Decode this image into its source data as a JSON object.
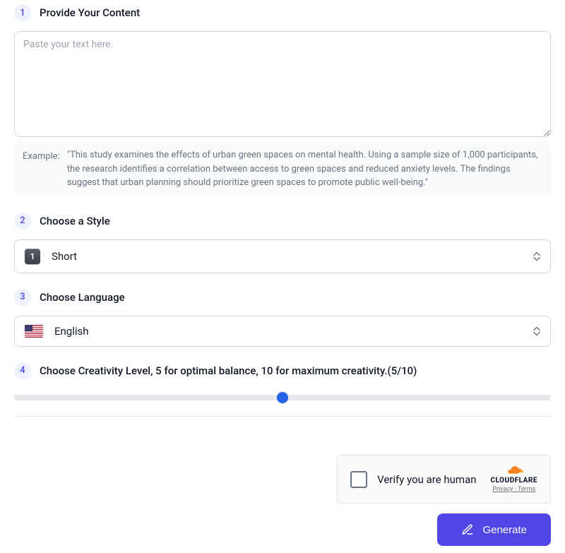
{
  "steps": {
    "s1": {
      "num": "1",
      "title": "Provide Your Content"
    },
    "s2": {
      "num": "2",
      "title": "Choose a Style"
    },
    "s3": {
      "num": "3",
      "title": "Choose Language"
    },
    "s4": {
      "num": "4",
      "title": "Choose Creativity Level, 5 for optimal balance, 10 for maximum creativity.(5/10)"
    }
  },
  "content": {
    "placeholder": "Paste your text here.",
    "value": ""
  },
  "example": {
    "label": "Example:",
    "text": "\"This study examines the effects of urban green spaces on mental health. Using a sample size of 1,000 participants, the research identifies a correlation between access to green spaces and reduced anxiety levels. The findings suggest that urban planning should prioritize green spaces to promote public well-being.\""
  },
  "style": {
    "icon_label": "1",
    "selected": "Short"
  },
  "language": {
    "selected": "English"
  },
  "creativity": {
    "min": 0,
    "max": 10,
    "value": 5
  },
  "captcha": {
    "label": "Verify you are human",
    "brand": "CLOUDFLARE",
    "privacy": "Privacy",
    "sep": " · ",
    "terms": "Terms"
  },
  "actions": {
    "generate": "Generate"
  }
}
